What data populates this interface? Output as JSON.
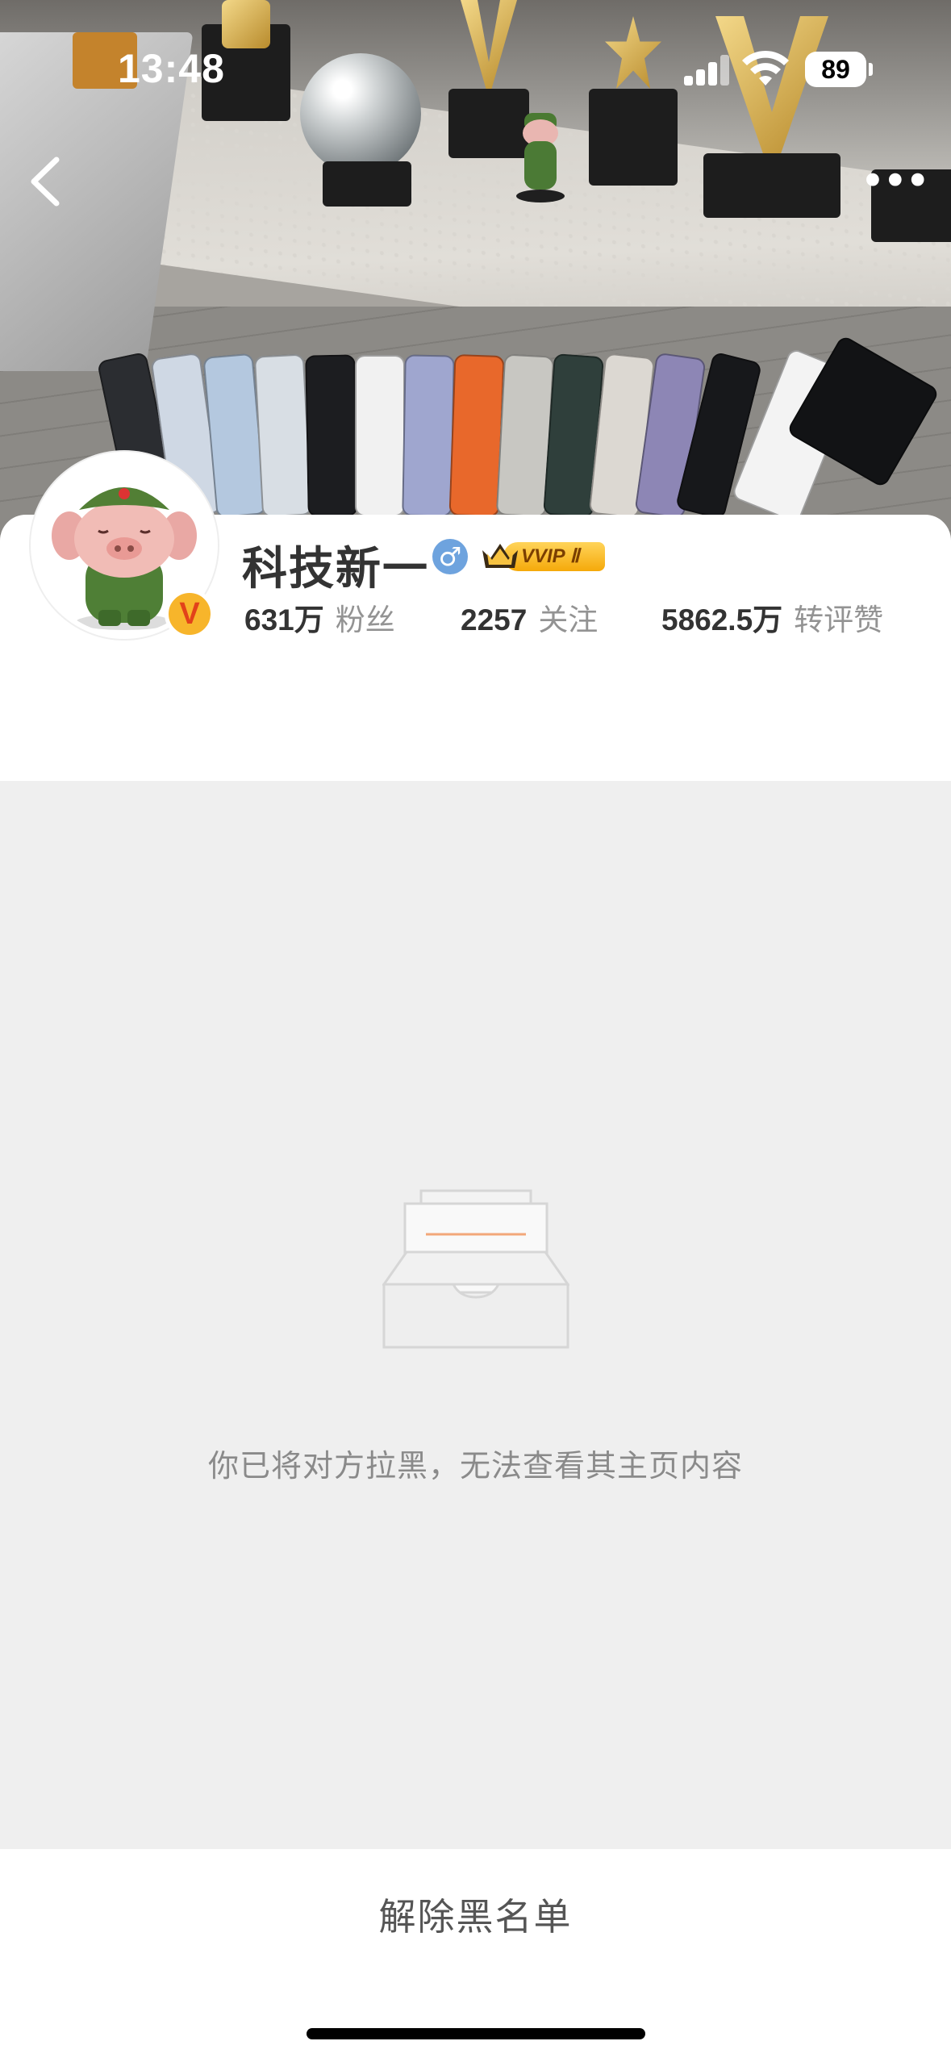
{
  "status_bar": {
    "time": "13:48",
    "battery": "89"
  },
  "profile": {
    "name": "科技新一",
    "gender_symbol": "♂",
    "vip_badge": "VVIP Ⅱ",
    "verified_badge": "V",
    "stats": [
      {
        "value": "631万",
        "label": "粉丝"
      },
      {
        "value": "2257",
        "label": "关注"
      },
      {
        "value": "5862.5万",
        "label": "转评赞"
      }
    ]
  },
  "blocked": {
    "message": "你已将对方拉黑，无法查看其主页内容"
  },
  "actions": {
    "unblock_label": "解除黑名单"
  },
  "nav": {
    "more_label": "•••"
  },
  "colors": {
    "vip_gold": "#f5a90a",
    "blocked_bg": "#efefef",
    "gender_blue": "#6ea3de",
    "verified_orange": "#f7b52b"
  }
}
